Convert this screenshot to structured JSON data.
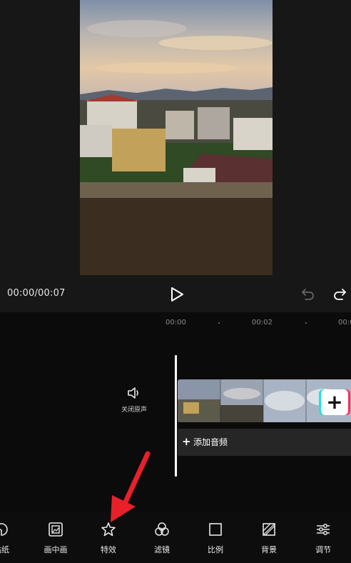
{
  "player": {
    "time": "00:00/00:07"
  },
  "timeline": {
    "ruler": [
      "00:00",
      "00:02",
      "00:0"
    ],
    "mute_label": "关闭原声",
    "add_audio_label": "添加音频",
    "add_clip_symbol": "+"
  },
  "toolbar": {
    "items": [
      {
        "label": "贴纸",
        "icon": "sticker-icon"
      },
      {
        "label": "画中画",
        "icon": "picture-in-picture-icon"
      },
      {
        "label": "特效",
        "icon": "effects-star-icon"
      },
      {
        "label": "滤镜",
        "icon": "filter-icon"
      },
      {
        "label": "比例",
        "icon": "ratio-icon"
      },
      {
        "label": "背景",
        "icon": "background-icon"
      },
      {
        "label": "调节",
        "icon": "adjust-icon"
      }
    ]
  },
  "colors": {
    "background": "#0d0d0d",
    "preview_background": "#171717",
    "annotation_arrow": "#e8202a",
    "add_button_accent_left": "#22e0e6",
    "add_button_accent_right": "#ff2d55"
  }
}
